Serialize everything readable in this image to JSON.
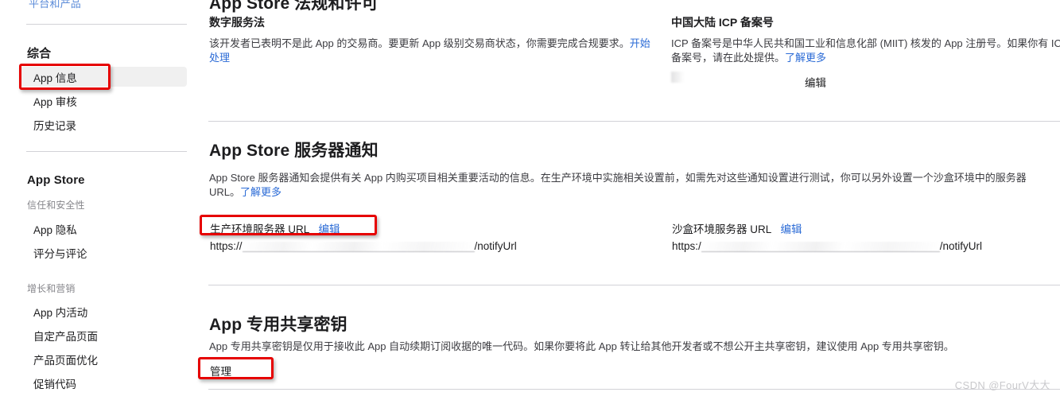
{
  "sidebar": {
    "top_link_partial": "平台和产品",
    "groups": [
      {
        "title": "综合",
        "items": [
          {
            "label": "App 信息",
            "selected": true
          },
          {
            "label": "App 审核",
            "selected": false
          },
          {
            "label": "历史记录",
            "selected": false
          }
        ]
      },
      {
        "title": "App Store",
        "subgroups": [
          {
            "label": "信任和安全性",
            "items": [
              {
                "label": "App 隐私"
              },
              {
                "label": "评分与评论"
              }
            ]
          },
          {
            "label": "增长和营销",
            "items": [
              {
                "label": "App 内活动"
              },
              {
                "label": "自定产品页面"
              },
              {
                "label": "产品页面优化"
              },
              {
                "label": "促销代码"
              }
            ]
          }
        ]
      }
    ]
  },
  "main": {
    "section_regulations": {
      "heading": "App Store 法规和许可",
      "left": {
        "title": "数字服务法",
        "body_before_link": "该开发者已表明不是此 App 的交易商。要更新 App 级别交易商状态，你需要完成合规要求。",
        "link": "开始处理"
      },
      "right": {
        "title": "中国大陆 ICP 备案号",
        "body_before_link": "ICP 备案号是中华人民共和国工业和信息化部 (MIIT) 核发的 App 注册号。如果你有 ICP 备案号，请在此处提供。",
        "link": "了解更多",
        "value": "",
        "edit_link": "编辑"
      }
    },
    "section_server_notifications": {
      "heading": "App Store 服务器通知",
      "body_before_link": "App Store 服务器通知会提供有关 App 内购买项目相关重要活动的信息。在生产环境中实施相关设置前，如需先对这些通知设置进行测试，你可以另外设置一个沙盒环境中的服务器 URL。",
      "link": "了解更多",
      "production": {
        "label": "生产环境服务器 URL",
        "edit_link": "编辑",
        "url_prefix": "https://",
        "url_suffix": "/notifyUrl"
      },
      "sandbox": {
        "label": "沙盒环境服务器 URL",
        "edit_link": "编辑",
        "url_prefix": "https:/",
        "url_suffix": "/notifyUrl"
      }
    },
    "section_shared_secret": {
      "heading": "App 专用共享密钥",
      "body": "App 专用共享密钥是仅用于接收此 App 自动续期订阅收据的唯一代码。如果你要将此 App 转让给其他开发者或不想公开主共享密钥，建议使用 App 专用共享密钥。",
      "manage_link": "管理"
    }
  },
  "watermark": "CSDN @FourV大大",
  "colors": {
    "link": "#2b6bd6",
    "annotation": "#e60000",
    "selected_bg": "#f0f0f0",
    "divider": "#d2d2d7",
    "text": "#1d1d1f",
    "muted": "#86868b"
  }
}
